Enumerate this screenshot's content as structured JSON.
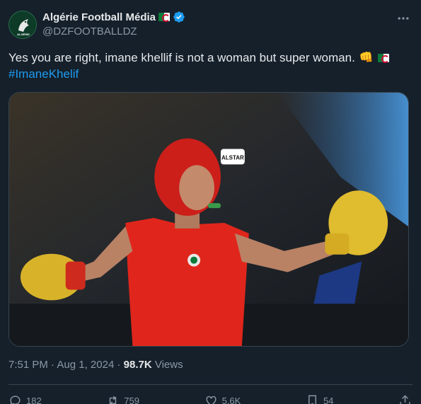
{
  "author": {
    "name": "Algérie Football Média",
    "handle": "@DZFOOTBALLDZ",
    "avatar_text": "ALGÉRIE"
  },
  "tweet": {
    "text": "Yes you are right, imane khellif is not a woman but super woman.",
    "hashtag": "#ImaneKhelif"
  },
  "media": {
    "headguard_text": "ALSTAR"
  },
  "meta": {
    "time": "7:51 PM",
    "separator": "·",
    "date": "Aug 1, 2024",
    "views_count": "98.7K",
    "views_label": "Views"
  },
  "actions": {
    "replies": "182",
    "reposts": "759",
    "likes": "5.6K",
    "bookmarks": "54"
  },
  "colors": {
    "background": "#15202b",
    "link": "#1d9bf0",
    "verified": "#1d9bf0",
    "secondary_text": "#8b98a5"
  }
}
